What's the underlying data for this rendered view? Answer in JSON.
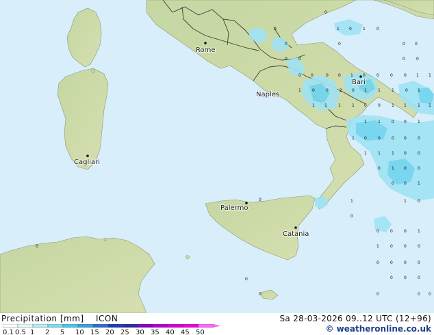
{
  "map": {
    "cities": [
      {
        "name": "Rome"
      },
      {
        "name": "Naples"
      },
      {
        "name": "Bari"
      },
      {
        "name": "Cagliari"
      },
      {
        "name": "Palermo"
      },
      {
        "name": "Catania"
      }
    ],
    "precip_values": [
      "0",
      "1",
      "0",
      "1",
      "0",
      "0",
      "0",
      "0",
      "0",
      "0",
      "0",
      "0",
      "0",
      "0",
      "0",
      "0",
      "0",
      "0",
      "1",
      "0",
      "0",
      "0",
      "0",
      "1",
      "1",
      "1",
      "0",
      "0",
      "2",
      "0",
      "1",
      "1",
      "1",
      "0",
      "1",
      "1",
      "1",
      "1",
      "1",
      "0",
      "0",
      "1",
      "1",
      "1",
      "1",
      "1",
      "1",
      "0",
      "0",
      "1",
      "1",
      "0",
      "0",
      "0",
      "0",
      "0",
      "1",
      "1",
      "1",
      "0",
      "0",
      "0",
      "1",
      "0",
      "0",
      "0",
      "0",
      "1",
      "1",
      "1",
      "0",
      "0",
      "0",
      "0",
      "0",
      "0",
      "1",
      "1",
      "0",
      "0",
      "0",
      "0",
      "0",
      "0",
      "0",
      "0",
      "0",
      "0",
      "0",
      "0",
      "0",
      "0",
      "0",
      "0",
      "0"
    ],
    "colors": {
      "sea": "#d8eefa",
      "land": "#c9d9a8",
      "rain_light": "#9fe3f5",
      "rain_medium": "#6fd4ee"
    }
  },
  "legend": {
    "title": "Precipitation [mm]",
    "model": "ICON",
    "tick_labels": [
      "0.1",
      "0.5",
      "1",
      "2",
      "5",
      "10",
      "15",
      "20",
      "25",
      "30",
      "35",
      "40",
      "45",
      "50"
    ],
    "colors": [
      "#ffffff",
      "#e6f8fd",
      "#b4ecf7",
      "#7ddcf1",
      "#45c7ea",
      "#3aa0e0",
      "#2a6fd0",
      "#1d3cb8",
      "#2a2aa0",
      "#8a00c8",
      "#b400d8",
      "#d800d8",
      "#f000e0",
      "#ff66ff"
    ]
  },
  "datetime": "Sa 28-03-2026 09..12 UTC (12+96)",
  "credit": "© weatheronline.co.uk"
}
